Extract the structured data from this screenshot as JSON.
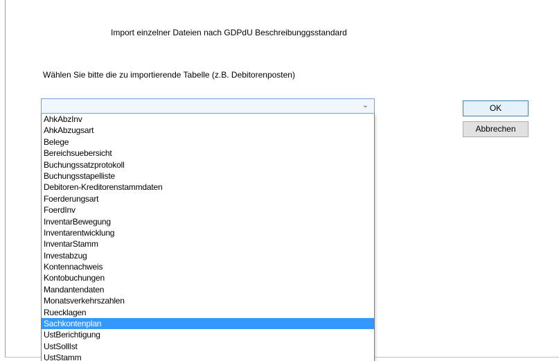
{
  "dialog": {
    "title": "Import einzelner Dateien nach GDPdU Beschreibunggsstandard",
    "instruction": "Wählen Sie bitte die zu importierende Tabelle (z.B. Debitorenposten)"
  },
  "combo": {
    "value": "",
    "items": [
      "AhkAbzInv",
      "AhkAbzugsart",
      "Belege",
      "Bereichsuebersicht",
      "Buchungssatzprotokoll",
      "Buchungsstapelliste",
      "Debitoren-Kreditorenstammdaten",
      "Foerderungsart",
      "FoerdInv",
      "InventarBewegung",
      "Inventarentwicklung",
      "InventarStamm",
      "Investabzug",
      "Kontennachweis",
      "Kontobuchungen",
      "Mandantendaten",
      "Monatsverkehrszahlen",
      "Ruecklagen",
      "Sachkontenplan",
      "UstBerichtigung",
      "UstSollIst",
      "UstStamm"
    ],
    "highlighted": "Sachkontenplan",
    "highlight_color": "#3399ff"
  },
  "buttons": {
    "ok": "OK",
    "cancel": "Abbrechen"
  }
}
